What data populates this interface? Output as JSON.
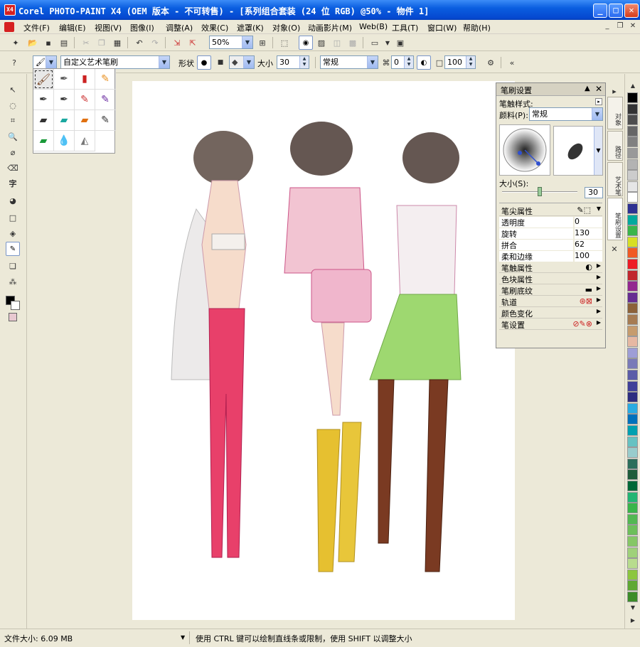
{
  "window": {
    "title": "Corel PHOTO-PAINT X4 (OEM 版本 - 不可转售) - [系列组合套装 (24 位 RGB) @50% - 物件 1]"
  },
  "menu": [
    "文件(F)",
    "编辑(E)",
    "视图(V)",
    "图像(I)",
    "调整(A)",
    "效果(C)",
    "遮罩(K)",
    "对象(O)",
    "动画影片(M)",
    "Web(B)",
    "工具(T)",
    "窗口(W)",
    "帮助(H)"
  ],
  "toolbar": {
    "zoom": "50%"
  },
  "property_bar": {
    "brush_type": "自定义艺术笔刷",
    "shape_label": "形状",
    "size_label": "大小",
    "size_value": "30",
    "merge_mode": "常规",
    "transparency": "0",
    "opacity": "100"
  },
  "docker": {
    "title": "笔刷设置",
    "nib_style_label": "笔触样式:",
    "paint_label": "颜料(P):",
    "paint_value": "常规",
    "size_label": "大小(S):",
    "size_value": "30",
    "tip_section": "笔尖属性",
    "properties": [
      {
        "label": "透明度",
        "value": "0"
      },
      {
        "label": "旋转",
        "value": "130"
      },
      {
        "label": "拼合",
        "value": "62"
      },
      {
        "label": "柔和边缘",
        "value": "100"
      }
    ],
    "sections": [
      "笔触属性",
      "色块属性",
      "笔刷底纹",
      "轨道",
      "颜色变化",
      "笔设置"
    ]
  },
  "vertical_tabs": [
    "对象",
    "路径",
    "艺术笔",
    "笔刷设置"
  ],
  "status": {
    "file_size": "文件大小: 6.09 MB",
    "hint": "使用 CTRL 键可以绘制直线条或限制，使用 SHIFT 以调整大小"
  },
  "colors": {
    "titlebar": "#0a5ee0",
    "accent": "#316ac5",
    "palette": [
      "#000000",
      "#333333",
      "#4d4d4d",
      "#666666",
      "#808080",
      "#999999",
      "#b3b3b3",
      "#cccccc",
      "#e6e6e6",
      "#ffffff",
      "#2e3192",
      "#00a99d",
      "#39b54a",
      "#d7df23",
      "#f15a24",
      "#ed1c24",
      "#c1272d",
      "#93278f",
      "#662d91",
      "#8c6239",
      "#a67c52",
      "#c69c6d",
      "#e6b8a2",
      "#9e9ed6",
      "#7a7ab8",
      "#5c5ca8",
      "#3f3f99",
      "#2d2d80",
      "#29abe2",
      "#0071bc",
      "#00a0b0",
      "#66c2c2",
      "#99cccc",
      "#2b6e5a",
      "#1e5c3a",
      "#006837",
      "#22b573",
      "#3ab54a",
      "#52b852",
      "#6dbf5a",
      "#86c766",
      "#9fd17a",
      "#b8dc8e",
      "#8cc63f",
      "#5fa832",
      "#3c8c28"
    ]
  }
}
